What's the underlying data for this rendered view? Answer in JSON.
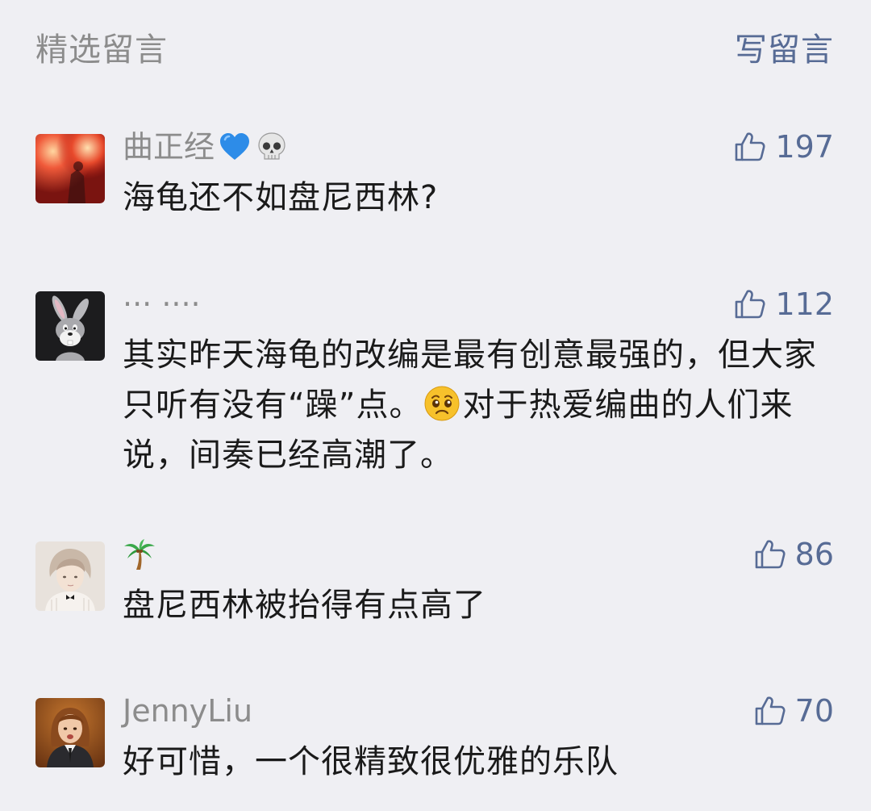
{
  "header": {
    "title": "精选留言",
    "write_label": "写留言"
  },
  "colors": {
    "background": "#efeff3",
    "nickname": "#8c8c8c",
    "link": "#576b95",
    "content": "#1a1a1a"
  },
  "comments": [
    {
      "nickname": "曲正经",
      "nickname_emojis": [
        "blue-heart-icon",
        "skull-icon"
      ],
      "likes": "197",
      "content": "海龟还不如盘尼西林?"
    },
    {
      "nickname": "··· ····",
      "likes": "112",
      "content_before": "其实昨天海龟的改编是最有创意最强的，但大家只听有没有“躁”点。",
      "content_emoji": "pleading-face-icon",
      "content_after": "对于热爱编曲的人们来说，间奏已经高潮了。"
    },
    {
      "nickname": "",
      "nickname_emojis": [
        "palm-tree-icon"
      ],
      "likes": "86",
      "content": "盘尼西林被抬得有点高了"
    },
    {
      "nickname": "JennyLiu",
      "likes": "70",
      "content": "好可惜，一个很精致很优雅的乐队"
    }
  ]
}
